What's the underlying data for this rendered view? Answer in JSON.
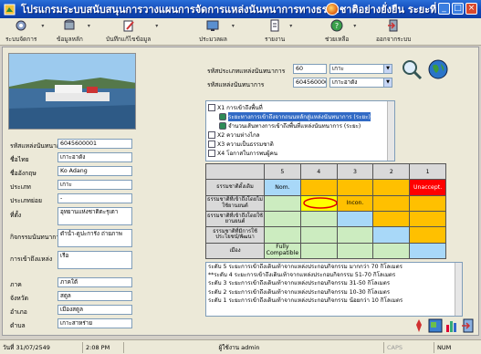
{
  "window": {
    "title": "โปรแกรมระบบสนับสนุนการวางแผนการจัดการแหล่งนันทนาการทางธรรมชาติอย่างยั่งยืน ระยะที่ 1"
  },
  "toolbar": {
    "items": [
      {
        "label": "ระบบจัดการ",
        "icon": "settings-icon"
      },
      {
        "label": "ข้อมูลหลัก",
        "icon": "database-icon"
      },
      {
        "label": "บันทึกแก้ไขข้อมูล",
        "icon": "edit-icon"
      },
      {
        "label": "ประมวลผล",
        "icon": "process-icon"
      },
      {
        "label": "รายงาน",
        "icon": "report-icon"
      },
      {
        "label": "ช่วยเหลือ",
        "icon": "help-icon"
      },
      {
        "label": "ออกจากระบบ",
        "icon": "exit-icon"
      }
    ]
  },
  "top_fields": {
    "zone_label": "รหัสประเภทแหล่งนันทนาการ",
    "zone_code": "60",
    "zone_name": "เกาะ",
    "site_label": "รหัสแหล่งนันทนาการ",
    "site_code": "6045600001",
    "site_name": "เกาะอาดัง"
  },
  "form": [
    {
      "label": "รหัสแหล่งนันทนาการ",
      "value": "6045600001"
    },
    {
      "label": "ชื่อไทย",
      "value": "เกาะอาดัง"
    },
    {
      "label": "ชื่ออังกฤษ",
      "value": "Ko Adang"
    },
    {
      "label": "ประเภท",
      "value": "เกาะ"
    },
    {
      "label": "ประเภทย่อย",
      "value": "-"
    },
    {
      "label": "ที่ตั้ง",
      "value": "อุทยานแห่งชาติตะรุเตา"
    },
    {
      "label": "กิจกรรมนันทนาการ",
      "value": "ดำน้ำ-ดูปะการัง ถ่ายภาพ"
    },
    {
      "label": "การเข้าถึงแหล่ง",
      "value": "เรือ"
    },
    {
      "label": "ภาค",
      "value": "ภาคใต้"
    },
    {
      "label": "จังหวัด",
      "value": "สตูล"
    },
    {
      "label": "อำเภอ",
      "value": "เมืองสตูล"
    },
    {
      "label": "ตำบล",
      "value": "เกาะสาหร่าย"
    }
  ],
  "tree": {
    "items": [
      {
        "label": "X1 การเข้าถึงพื้นที่",
        "level": 0
      },
      {
        "label": "ระยะทางการเข้าถึงจากถนนหลักสู่แหล่งนันทนาการ (ระยะ)",
        "level": 1,
        "selected": true
      },
      {
        "label": "จำนวนเส้นทางการเข้าถึงพื้นที่แหล่งนันทนาการ (ระยะ)",
        "level": 1
      },
      {
        "label": "X2 ความห่างไกล",
        "level": 0
      },
      {
        "label": "X3 ความเป็นธรรมชาติ",
        "level": 0
      },
      {
        "label": "X4 โอกาสในการพบผู้คน",
        "level": 0
      }
    ]
  },
  "matrix": {
    "columns": [
      "5",
      "4",
      "3",
      "2",
      "1"
    ],
    "rows": [
      {
        "label": "ธรรมชาติดั้งเดิม",
        "cells": [
          "Nom.",
          "",
          "",
          "",
          "Unaccept."
        ],
        "colors": [
          "blue",
          "orange",
          "orange",
          "orange",
          "red"
        ]
      },
      {
        "label": "ธรรมชาติที่เข้าถึงโดยไม่ใช้ยานยนต์",
        "cells": [
          "",
          "",
          "Incon.",
          "",
          ""
        ],
        "colors": [
          "lgreen",
          "yellow",
          "orange",
          "orange",
          "orange"
        ]
      },
      {
        "label": "ธรรมชาติที่เข้าถึงโดยใช้ยานยนต์",
        "cells": [
          "",
          "",
          "",
          "",
          ""
        ],
        "colors": [
          "lgreen",
          "lgreen",
          "blue",
          "orange",
          "orange"
        ]
      },
      {
        "label": "ธรรมชาติที่มีการใช้ประโยชน์/พัฒนา",
        "cells": [
          "",
          "",
          "",
          "",
          ""
        ],
        "colors": [
          "lgreen",
          "lgreen",
          "lgreen",
          "blue",
          "orange"
        ]
      },
      {
        "label": "เมือง",
        "cells": [
          "Fully Compatible",
          "",
          "",
          "",
          ""
        ],
        "colors": [
          "lgreen",
          "lgreen",
          "lgreen",
          "lgreen",
          "blue"
        ]
      }
    ]
  },
  "notes": [
    "ระดับ 5 ระยะการเข้าถึงเดินเท้าจากแหล่งประกอบกิจกรรม มากกว่า 70 กิโลเมตร",
    "**ระดับ 4 ระยะการเข้าถึงเดินเท้าจากแหล่งประกอบกิจกรรม 51-70 กิโลเมตร",
    "ระดับ 3 ระยะการเข้าถึงเดินเท้าจากแหล่งประกอบกิจกรรม 31-50 กิโลเมตร",
    "ระดับ 2 ระยะการเข้าถึงเดินเท้าจากแหล่งประกอบกิจกรรม 10-30 กิโลเมตร",
    "ระดับ 1 ระยะการเข้าถึงเดินเท้าจากแหล่งประกอบกิจกรรม น้อยกว่า 10 กิโลเมตร"
  ],
  "status": {
    "date": "วันที่ 31/07/2549",
    "time": "2:08 PM",
    "user": "ผู้ใช้งาน admin",
    "caps": "CAPS",
    "num": "NUM"
  },
  "colors": {
    "blue": "#a8d8f8",
    "orange": "#ffc000",
    "lgreen": "#ccecc0",
    "red": "#ff0000",
    "yellow": "#ffff00"
  }
}
